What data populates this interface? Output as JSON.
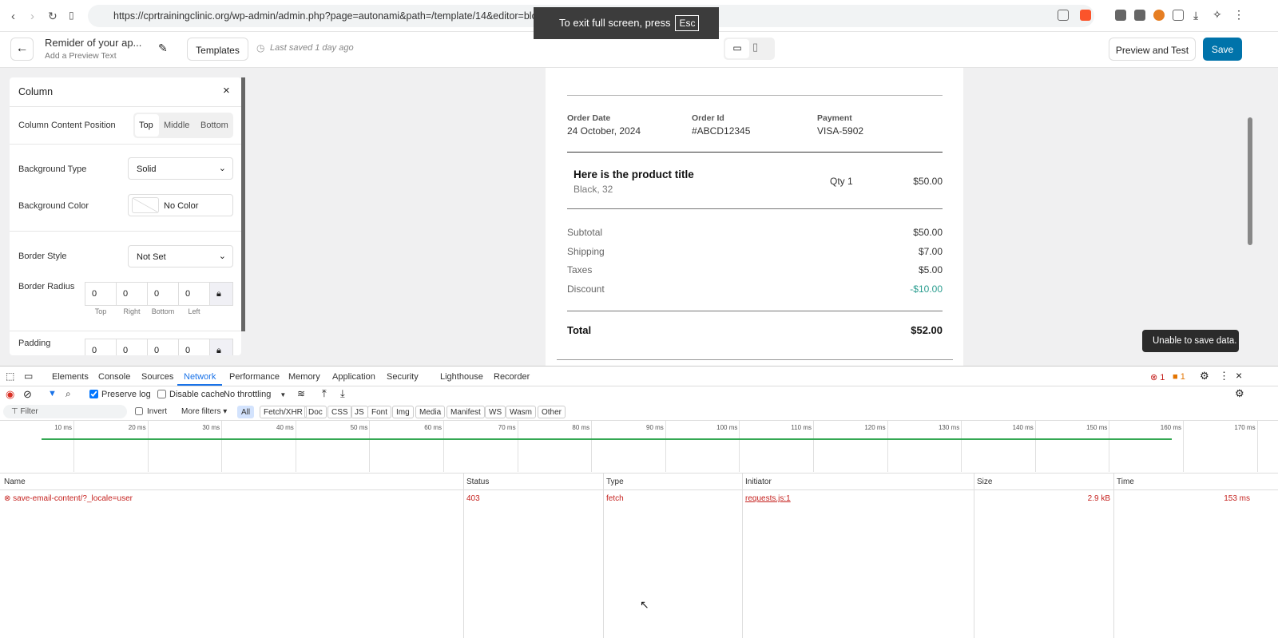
{
  "browser": {
    "url": "https://cprtrainingclinic.org/wp-admin/admin.php?page=autonami&path=/template/14&editor=block",
    "fullscreen_notice": "To exit full screen, press",
    "esc_key": "Esc"
  },
  "editor": {
    "title": "Remider of your ap...",
    "preview_text": "Add a Preview Text",
    "templates": "Templates",
    "last_saved": "Last saved 1 day ago",
    "preview_test": "Preview and Test",
    "save": "Save"
  },
  "panel": {
    "title": "Column",
    "content_position_label": "Column Content Position",
    "positions": [
      "Top",
      "Middle",
      "Bottom"
    ],
    "selected_position": "Top",
    "bg_type_label": "Background Type",
    "bg_type": "Solid",
    "bg_color_label": "Background Color",
    "bg_color": "No Color",
    "border_style_label": "Border Style",
    "border_style": "Not Set",
    "border_radius_label": "Border Radius",
    "radius": [
      "0",
      "0",
      "0",
      "0"
    ],
    "sides": [
      "Top",
      "Right",
      "Bottom",
      "Left"
    ],
    "padding_label": "Padding",
    "padding": [
      "0",
      "0",
      "0",
      "0"
    ]
  },
  "email": {
    "order_date_label": "Order Date",
    "order_date": "24 October, 2024",
    "order_id_label": "Order Id",
    "order_id": "#ABCD12345",
    "payment_label": "Payment",
    "payment": "VISA-5902",
    "product_title": "Here is the product title",
    "variant": "Black, 32",
    "qty": "Qty 1",
    "price": "$50.00",
    "summary": [
      {
        "label": "Subtotal",
        "value": "$50.00"
      },
      {
        "label": "Shipping",
        "value": "$7.00"
      },
      {
        "label": "Taxes",
        "value": "$5.00"
      },
      {
        "label": "Discount",
        "value": "-$10.00"
      }
    ],
    "total_label": "Total",
    "total": "$52.00",
    "discount_color": "#2a9d8f"
  },
  "toast": "Unable to save data.",
  "devtools": {
    "tabs": [
      "Elements",
      "Console",
      "Sources",
      "Network",
      "Performance",
      "Memory",
      "Application",
      "Security",
      "Lighthouse",
      "Recorder"
    ],
    "active_tab": "Network",
    "errors": "1",
    "warnings": "1",
    "preserve_log": "Preserve log",
    "disable_cache": "Disable cache",
    "throttling": "No throttling",
    "filter_placeholder": "Filter",
    "invert": "Invert",
    "more_filters": "More filters",
    "filters": [
      "All",
      "Fetch/XHR",
      "Doc",
      "CSS",
      "JS",
      "Font",
      "Img",
      "Media",
      "Manifest",
      "WS",
      "Wasm",
      "Other"
    ],
    "ticks": [
      "10 ms",
      "20 ms",
      "30 ms",
      "40 ms",
      "50 ms",
      "60 ms",
      "70 ms",
      "80 ms",
      "90 ms",
      "100 ms",
      "110 ms",
      "120 ms",
      "130 ms",
      "140 ms",
      "150 ms",
      "160 ms",
      "170 ms"
    ],
    "columns": [
      "Name",
      "Status",
      "Type",
      "Initiator",
      "Size",
      "Time"
    ],
    "rows": [
      {
        "name": "save-email-content/?_locale=user",
        "status": "403",
        "type": "fetch",
        "initiator": "requests.js:1",
        "size": "2.9 kB",
        "time": "153 ms"
      }
    ]
  }
}
